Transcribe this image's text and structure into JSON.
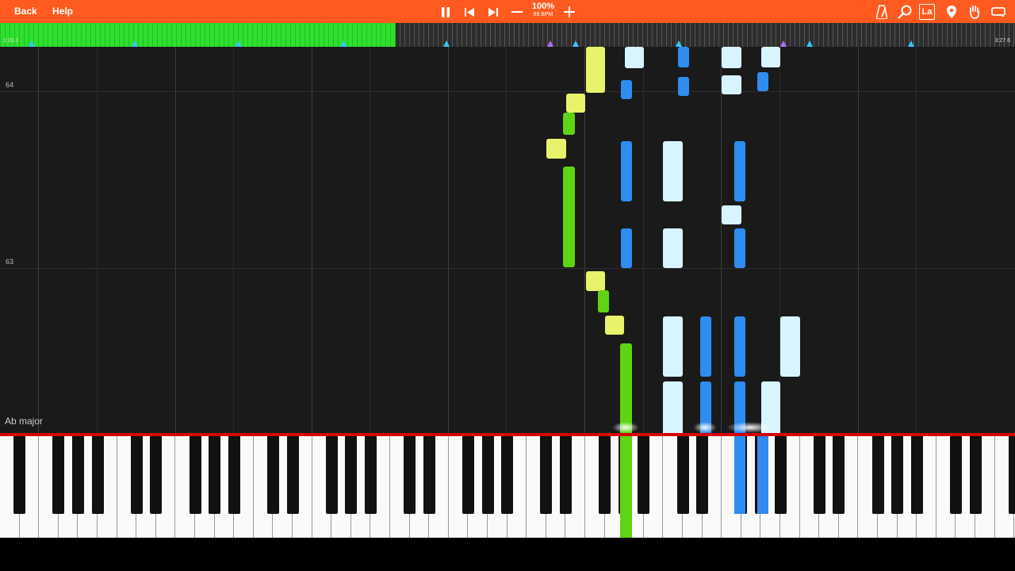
{
  "toolbar": {
    "back_label": "Back",
    "help_label": "Help",
    "zoom": "100%",
    "bpm": "89 BPM",
    "icons": [
      "pause-icon",
      "skip-back-icon",
      "skip-forward-icon",
      "minus-icon",
      "plus-icon",
      "metronome-icon",
      "search-icon",
      "label-icon",
      "location-pin-icon",
      "hand-icon",
      "loop-icon"
    ],
    "label_button": "La"
  },
  "timeline": {
    "elapsed": "1:20.1",
    "total": "3:27.6",
    "progress": 0.39,
    "markers": [
      0.031,
      0.133,
      0.235,
      0.338,
      0.44,
      0.542,
      0.567,
      0.669,
      0.772,
      0.798,
      0.898
    ],
    "purple_markers": [
      0.542,
      0.772
    ]
  },
  "roll": {
    "measure_labels": [
      "64",
      "63"
    ],
    "key_signature": "Ab major"
  },
  "colors": {
    "toolbar": "#ff5a1f",
    "progress": "#2fe02f",
    "right_hand_dark": "#2f8cf0",
    "right_hand_light": "#d8f4ff",
    "left_hand_dark": "#5fd414",
    "left_hand_light": "#e8f26a",
    "keyboard_accent": "#d40000"
  }
}
